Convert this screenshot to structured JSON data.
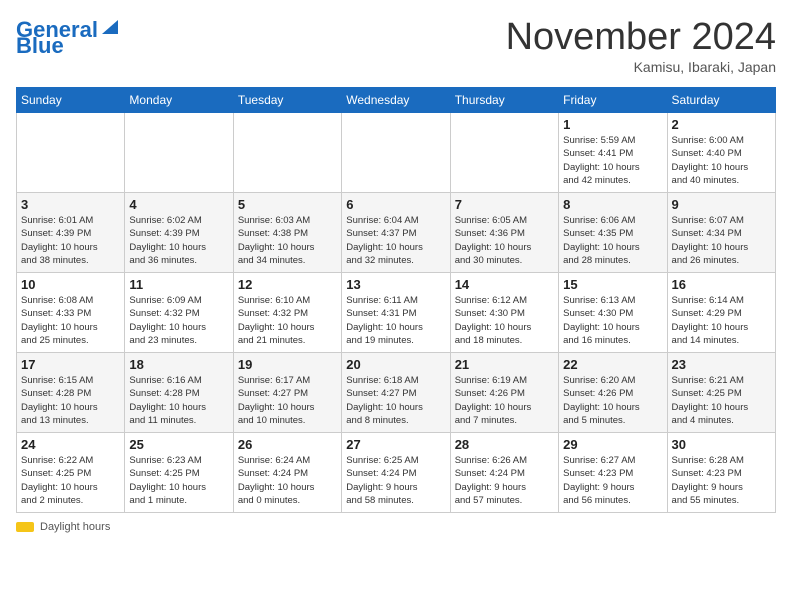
{
  "header": {
    "logo_line1": "General",
    "logo_line2": "Blue",
    "month": "November 2024",
    "location": "Kamisu, Ibaraki, Japan"
  },
  "weekdays": [
    "Sunday",
    "Monday",
    "Tuesday",
    "Wednesday",
    "Thursday",
    "Friday",
    "Saturday"
  ],
  "weeks": [
    [
      {
        "day": "",
        "info": ""
      },
      {
        "day": "",
        "info": ""
      },
      {
        "day": "",
        "info": ""
      },
      {
        "day": "",
        "info": ""
      },
      {
        "day": "",
        "info": ""
      },
      {
        "day": "1",
        "info": "Sunrise: 5:59 AM\nSunset: 4:41 PM\nDaylight: 10 hours\nand 42 minutes."
      },
      {
        "day": "2",
        "info": "Sunrise: 6:00 AM\nSunset: 4:40 PM\nDaylight: 10 hours\nand 40 minutes."
      }
    ],
    [
      {
        "day": "3",
        "info": "Sunrise: 6:01 AM\nSunset: 4:39 PM\nDaylight: 10 hours\nand 38 minutes."
      },
      {
        "day": "4",
        "info": "Sunrise: 6:02 AM\nSunset: 4:39 PM\nDaylight: 10 hours\nand 36 minutes."
      },
      {
        "day": "5",
        "info": "Sunrise: 6:03 AM\nSunset: 4:38 PM\nDaylight: 10 hours\nand 34 minutes."
      },
      {
        "day": "6",
        "info": "Sunrise: 6:04 AM\nSunset: 4:37 PM\nDaylight: 10 hours\nand 32 minutes."
      },
      {
        "day": "7",
        "info": "Sunrise: 6:05 AM\nSunset: 4:36 PM\nDaylight: 10 hours\nand 30 minutes."
      },
      {
        "day": "8",
        "info": "Sunrise: 6:06 AM\nSunset: 4:35 PM\nDaylight: 10 hours\nand 28 minutes."
      },
      {
        "day": "9",
        "info": "Sunrise: 6:07 AM\nSunset: 4:34 PM\nDaylight: 10 hours\nand 26 minutes."
      }
    ],
    [
      {
        "day": "10",
        "info": "Sunrise: 6:08 AM\nSunset: 4:33 PM\nDaylight: 10 hours\nand 25 minutes."
      },
      {
        "day": "11",
        "info": "Sunrise: 6:09 AM\nSunset: 4:32 PM\nDaylight: 10 hours\nand 23 minutes."
      },
      {
        "day": "12",
        "info": "Sunrise: 6:10 AM\nSunset: 4:32 PM\nDaylight: 10 hours\nand 21 minutes."
      },
      {
        "day": "13",
        "info": "Sunrise: 6:11 AM\nSunset: 4:31 PM\nDaylight: 10 hours\nand 19 minutes."
      },
      {
        "day": "14",
        "info": "Sunrise: 6:12 AM\nSunset: 4:30 PM\nDaylight: 10 hours\nand 18 minutes."
      },
      {
        "day": "15",
        "info": "Sunrise: 6:13 AM\nSunset: 4:30 PM\nDaylight: 10 hours\nand 16 minutes."
      },
      {
        "day": "16",
        "info": "Sunrise: 6:14 AM\nSunset: 4:29 PM\nDaylight: 10 hours\nand 14 minutes."
      }
    ],
    [
      {
        "day": "17",
        "info": "Sunrise: 6:15 AM\nSunset: 4:28 PM\nDaylight: 10 hours\nand 13 minutes."
      },
      {
        "day": "18",
        "info": "Sunrise: 6:16 AM\nSunset: 4:28 PM\nDaylight: 10 hours\nand 11 minutes."
      },
      {
        "day": "19",
        "info": "Sunrise: 6:17 AM\nSunset: 4:27 PM\nDaylight: 10 hours\nand 10 minutes."
      },
      {
        "day": "20",
        "info": "Sunrise: 6:18 AM\nSunset: 4:27 PM\nDaylight: 10 hours\nand 8 minutes."
      },
      {
        "day": "21",
        "info": "Sunrise: 6:19 AM\nSunset: 4:26 PM\nDaylight: 10 hours\nand 7 minutes."
      },
      {
        "day": "22",
        "info": "Sunrise: 6:20 AM\nSunset: 4:26 PM\nDaylight: 10 hours\nand 5 minutes."
      },
      {
        "day": "23",
        "info": "Sunrise: 6:21 AM\nSunset: 4:25 PM\nDaylight: 10 hours\nand 4 minutes."
      }
    ],
    [
      {
        "day": "24",
        "info": "Sunrise: 6:22 AM\nSunset: 4:25 PM\nDaylight: 10 hours\nand 2 minutes."
      },
      {
        "day": "25",
        "info": "Sunrise: 6:23 AM\nSunset: 4:25 PM\nDaylight: 10 hours\nand 1 minute."
      },
      {
        "day": "26",
        "info": "Sunrise: 6:24 AM\nSunset: 4:24 PM\nDaylight: 10 hours\nand 0 minutes."
      },
      {
        "day": "27",
        "info": "Sunrise: 6:25 AM\nSunset: 4:24 PM\nDaylight: 9 hours\nand 58 minutes."
      },
      {
        "day": "28",
        "info": "Sunrise: 6:26 AM\nSunset: 4:24 PM\nDaylight: 9 hours\nand 57 minutes."
      },
      {
        "day": "29",
        "info": "Sunrise: 6:27 AM\nSunset: 4:23 PM\nDaylight: 9 hours\nand 56 minutes."
      },
      {
        "day": "30",
        "info": "Sunrise: 6:28 AM\nSunset: 4:23 PM\nDaylight: 9 hours\nand 55 minutes."
      }
    ]
  ],
  "footer": {
    "daylight_label": "Daylight hours"
  }
}
